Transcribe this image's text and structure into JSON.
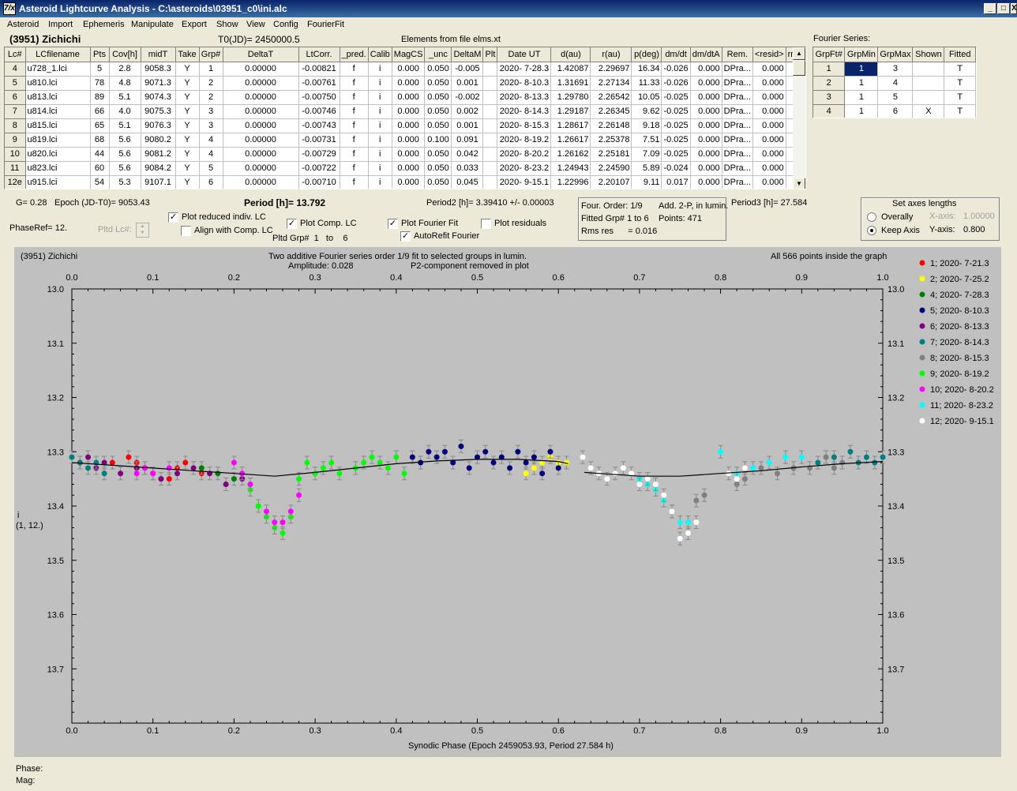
{
  "window": {
    "title": "Asteroid Lightcurve Analysis - C:\\asteroids\\03951_c0\\ini.alc",
    "icon": "7/x",
    "buttons": [
      "_",
      "□",
      "X"
    ]
  },
  "menu": [
    "Asteroid",
    "Import",
    "Ephemeris",
    "Manipulate",
    "Export",
    "Show",
    "View",
    "Config",
    "FourierFit"
  ],
  "header": {
    "asteroid": "(3951) Zichichi",
    "t0": "T0(JD)= 2450000.5",
    "elements": "Elements from file elms.xt",
    "fourier_title": "Fourier Series:"
  },
  "grid": {
    "columns": [
      "Lc#",
      "LCfilename",
      "Pts",
      "Cov[h]",
      "midT",
      "Take",
      "Grp#",
      "DeltaT",
      "LtCorr.",
      "_pred.",
      "Calib",
      "MagCS",
      "_unc",
      "DeltaM",
      "Plt",
      "Date UT",
      "d(au)",
      "r(au)",
      "p(deg)",
      "dm/dt",
      "dm/dtA",
      "Rem.",
      "<resid>",
      "rms res"
    ],
    "rows": [
      [
        "4",
        "u728_1.lci",
        "5",
        "2.8",
        "9058.3",
        "Y",
        "1",
        "0.00000",
        "-0.00821",
        "f",
        "i",
        "0.000",
        "0.050",
        "-0.005",
        "",
        "2020- 7-28.3",
        "1.42087",
        "2.29697",
        "16.34",
        "-0.026",
        "0.000",
        "DPra...",
        "0.000",
        "0.008"
      ],
      [
        "5",
        "u810.lci",
        "78",
        "4.8",
        "9071.3",
        "Y",
        "2",
        "0.00000",
        "-0.00761",
        "f",
        "i",
        "0.000",
        "0.050",
        "0.001",
        "",
        "2020- 8-10.3",
        "1.31691",
        "2.27134",
        "11.33",
        "-0.026",
        "0.000",
        "DPra...",
        "0.000",
        "0.018"
      ],
      [
        "6",
        "u813.lci",
        "89",
        "5.1",
        "9074.3",
        "Y",
        "2",
        "0.00000",
        "-0.00750",
        "f",
        "i",
        "0.000",
        "0.050",
        "-0.002",
        "",
        "2020- 8-13.3",
        "1.29780",
        "2.26542",
        "10.05",
        "-0.025",
        "0.000",
        "DPra...",
        "0.000",
        "0.016"
      ],
      [
        "7",
        "u814.lci",
        "66",
        "4.0",
        "9075.3",
        "Y",
        "3",
        "0.00000",
        "-0.00746",
        "f",
        "i",
        "0.000",
        "0.050",
        "0.002",
        "",
        "2020- 8-14.3",
        "1.29187",
        "2.26345",
        "9.62",
        "-0.025",
        "0.000",
        "DPra...",
        "0.000",
        "0.015"
      ],
      [
        "8",
        "u815.lci",
        "65",
        "5.1",
        "9076.3",
        "Y",
        "3",
        "0.00000",
        "-0.00743",
        "f",
        "i",
        "0.000",
        "0.050",
        "0.001",
        "",
        "2020- 8-15.3",
        "1.28617",
        "2.26148",
        "9.18",
        "-0.025",
        "0.000",
        "DPra...",
        "0.000",
        "0.017"
      ],
      [
        "9",
        "u819.lci",
        "68",
        "5.6",
        "9080.2",
        "Y",
        "4",
        "0.00000",
        "-0.00731",
        "f",
        "i",
        "0.000",
        "0.100",
        "0.091",
        "",
        "2020- 8-19.2",
        "1.26617",
        "2.25378",
        "7.51",
        "-0.025",
        "0.000",
        "DPra...",
        "0.000",
        "0.015"
      ],
      [
        "10",
        "u820.lci",
        "44",
        "5.6",
        "9081.2",
        "Y",
        "4",
        "0.00000",
        "-0.00729",
        "f",
        "i",
        "0.000",
        "0.050",
        "0.042",
        "",
        "2020- 8-20.2",
        "1.26162",
        "2.25181",
        "7.09",
        "-0.025",
        "0.000",
        "DPra...",
        "0.000",
        "0.016"
      ],
      [
        "11",
        "u823.lci",
        "60",
        "5.6",
        "9084.2",
        "Y",
        "5",
        "0.00000",
        "-0.00722",
        "f",
        "i",
        "0.000",
        "0.050",
        "0.033",
        "",
        "2020- 8-23.2",
        "1.24943",
        "2.24590",
        "5.89",
        "-0.024",
        "0.000",
        "DPra...",
        "0.000",
        "0.011"
      ],
      [
        "12e",
        "u915.lci",
        "54",
        "5.3",
        "9107.1",
        "Y",
        "6",
        "0.00000",
        "-0.00710",
        "f",
        "i",
        "0.000",
        "0.050",
        "0.045",
        "",
        "2020- 9-15.1",
        "1.22996",
        "2.20107",
        "9.11",
        "0.017",
        "0.000",
        "DPra...",
        "0.000",
        "0.015"
      ]
    ]
  },
  "fourier": {
    "columns": [
      "GrpFt#",
      "GrpMin",
      "GrpMax",
      "Shown",
      "Fitted"
    ],
    "rows": [
      [
        "1",
        "1",
        "3",
        "",
        "T"
      ],
      [
        "2",
        "1",
        "4",
        "",
        "T"
      ],
      [
        "3",
        "1",
        "5",
        "",
        "T"
      ],
      [
        "4",
        "1",
        "6",
        "X",
        "T"
      ]
    ]
  },
  "controls": {
    "g": "G= 0.28",
    "epoch": "Epoch (JD-T0)= 9053.43",
    "period": "Period [h]= 13.792",
    "period2": "Period2 [h]= 3.39410 +/- 0.00003",
    "period3": "Period3 [h]= 27.584",
    "phaseref": "PhaseRef= 12.",
    "pltd_lc": "Pltd Lc#:",
    "cb_reduced": "Plot reduced indiv. LC",
    "cb_align": "Align with Comp. LC",
    "cb_comp": "Plot Comp. LC",
    "cb_fourier": "Plot Fourier Fit",
    "cb_resid": "Plot residuals",
    "cb_autorefit": "AutoRefit Fourier",
    "pltd_grp": "Pltd Grp#",
    "pltd_grp_from": "1",
    "pltd_to": "to",
    "pltd_grp_to": "6",
    "four_order": "Four. Order:  1/9",
    "add2p": "Add. 2-P, in lumin.",
    "fitted_grp": "Fitted Grp# 1 to 6",
    "points": "Points: 471",
    "rms": "Rms res      = 0.016",
    "axes_title": "Set axes lengths",
    "overally": "Overally",
    "keep_axis": "Keep Axis",
    "xaxis_label": "X-axis:",
    "xaxis_val": "1.00000",
    "yaxis_label": "Y-axis:",
    "yaxis_val": "0.800"
  },
  "plot": {
    "name": "(3951) Zichichi",
    "subtitle1": "Two additive Fourier series order 1/9 fit to selected groups in lumin.",
    "subtitle2": "Amplitude: 0.028",
    "subtitle3": "P2-component removed in plot",
    "note": "All 566 points inside the graph",
    "ylabel1": "i",
    "ylabel2": "(1, 12.)",
    "xlabel": "Synodic Phase (Epoch 2459053.93, Period 27.584 h)"
  },
  "status": {
    "phase": "Phase:",
    "mag": "Mag:"
  },
  "chart_data": {
    "type": "scatter",
    "xlim": [
      0.0,
      1.0
    ],
    "ylim": [
      13.0,
      13.8
    ],
    "y_inverted": true,
    "grid": false,
    "legend": "right",
    "xticks": [
      "0.0",
      "0.1",
      "0.2",
      "0.3",
      "0.4",
      "0.5",
      "0.6",
      "0.7",
      "0.8",
      "0.9",
      "1.0"
    ],
    "yticks": [
      "13.0",
      "13.1",
      "13.2",
      "13.3",
      "13.4",
      "13.5",
      "13.6",
      "13.7"
    ],
    "series": [
      {
        "name": "1; 2020- 7-21.3",
        "color": "#ff0000",
        "points": [
          [
            0.05,
            13.32
          ],
          [
            0.07,
            13.31
          ],
          [
            0.08,
            13.32
          ],
          [
            0.1,
            13.34
          ],
          [
            0.12,
            13.35
          ],
          [
            0.13,
            13.33
          ],
          [
            0.14,
            13.32
          ],
          [
            0.16,
            13.34
          ]
        ]
      },
      {
        "name": "2; 2020- 7-25.2",
        "color": "#ffff00",
        "points": [
          [
            0.56,
            13.34
          ],
          [
            0.57,
            13.33
          ],
          [
            0.58,
            13.32
          ],
          [
            0.59,
            13.31
          ],
          [
            0.6,
            13.32
          ],
          [
            0.61,
            13.32
          ]
        ]
      },
      {
        "name": "4; 2020- 7-28.3",
        "color": "#008000",
        "points": [
          [
            0.16,
            13.33
          ],
          [
            0.18,
            13.34
          ],
          [
            0.2,
            13.35
          ]
        ]
      },
      {
        "name": "5; 2020- 8-10.3",
        "color": "#000080",
        "points": [
          [
            0.42,
            13.31
          ],
          [
            0.43,
            13.32
          ],
          [
            0.44,
            13.3
          ],
          [
            0.45,
            13.31
          ],
          [
            0.46,
            13.3
          ],
          [
            0.47,
            13.32
          ],
          [
            0.48,
            13.29
          ],
          [
            0.49,
            13.33
          ],
          [
            0.5,
            13.31
          ],
          [
            0.51,
            13.3
          ],
          [
            0.52,
            13.32
          ],
          [
            0.53,
            13.31
          ],
          [
            0.54,
            13.33
          ],
          [
            0.55,
            13.3
          ],
          [
            0.56,
            13.32
          ],
          [
            0.57,
            13.31
          ],
          [
            0.58,
            13.34
          ],
          [
            0.59,
            13.3
          ],
          [
            0.6,
            13.33
          ]
        ]
      },
      {
        "name": "6; 2020- 8-13.3",
        "color": "#800080",
        "points": [
          [
            0.01,
            13.32
          ],
          [
            0.02,
            13.31
          ],
          [
            0.03,
            13.33
          ],
          [
            0.04,
            13.32
          ],
          [
            0.06,
            13.34
          ],
          [
            0.08,
            13.33
          ],
          [
            0.09,
            13.33
          ],
          [
            0.11,
            13.35
          ],
          [
            0.13,
            13.34
          ],
          [
            0.15,
            13.33
          ],
          [
            0.17,
            13.34
          ],
          [
            0.19,
            13.36
          ],
          [
            0.21,
            13.35
          ]
        ]
      },
      {
        "name": "7; 2020- 8-14.3",
        "color": "#008080",
        "points": [
          [
            0.0,
            13.31
          ],
          [
            0.01,
            13.32
          ],
          [
            0.02,
            13.33
          ],
          [
            0.03,
            13.32
          ],
          [
            0.04,
            13.34
          ],
          [
            0.92,
            13.32
          ],
          [
            0.94,
            13.31
          ],
          [
            0.96,
            13.3
          ],
          [
            0.97,
            13.32
          ],
          [
            0.98,
            13.31
          ],
          [
            0.99,
            13.32
          ],
          [
            1.0,
            13.31
          ]
        ]
      },
      {
        "name": "8; 2020- 8-15.3",
        "color": "#808080",
        "points": [
          [
            0.77,
            13.39
          ],
          [
            0.78,
            13.38
          ],
          [
            0.82,
            13.36
          ],
          [
            0.83,
            13.35
          ],
          [
            0.85,
            13.33
          ],
          [
            0.87,
            13.34
          ],
          [
            0.89,
            13.33
          ],
          [
            0.91,
            13.33
          ],
          [
            0.93,
            13.31
          ],
          [
            0.94,
            13.33
          ],
          [
            0.95,
            13.32
          ]
        ]
      },
      {
        "name": "9; 2020- 8-19.2",
        "color": "#00ff00",
        "points": [
          [
            0.22,
            13.37
          ],
          [
            0.23,
            13.4
          ],
          [
            0.24,
            13.42
          ],
          [
            0.25,
            13.44
          ],
          [
            0.26,
            13.45
          ],
          [
            0.27,
            13.42
          ],
          [
            0.28,
            13.35
          ],
          [
            0.29,
            13.32
          ],
          [
            0.3,
            13.34
          ],
          [
            0.31,
            13.33
          ],
          [
            0.32,
            13.32
          ],
          [
            0.33,
            13.34
          ],
          [
            0.35,
            13.33
          ],
          [
            0.36,
            13.32
          ],
          [
            0.37,
            13.31
          ],
          [
            0.38,
            13.32
          ],
          [
            0.39,
            13.33
          ],
          [
            0.4,
            13.31
          ],
          [
            0.41,
            13.34
          ]
        ]
      },
      {
        "name": "10; 2020- 8-20.2",
        "color": "#ff00ff",
        "points": [
          [
            0.08,
            13.34
          ],
          [
            0.09,
            13.33
          ],
          [
            0.1,
            13.34
          ],
          [
            0.12,
            13.33
          ],
          [
            0.2,
            13.32
          ],
          [
            0.21,
            13.34
          ],
          [
            0.22,
            13.36
          ],
          [
            0.24,
            13.41
          ],
          [
            0.25,
            13.43
          ],
          [
            0.26,
            13.43
          ],
          [
            0.27,
            13.41
          ],
          [
            0.28,
            13.38
          ]
        ]
      },
      {
        "name": "11; 2020- 8-23.2",
        "color": "#00ffff",
        "points": [
          [
            0.7,
            13.35
          ],
          [
            0.71,
            13.36
          ],
          [
            0.72,
            13.37
          ],
          [
            0.73,
            13.39
          ],
          [
            0.74,
            13.41
          ],
          [
            0.75,
            13.43
          ],
          [
            0.76,
            13.43
          ],
          [
            0.8,
            13.3
          ],
          [
            0.82,
            13.34
          ],
          [
            0.84,
            13.33
          ],
          [
            0.86,
            13.32
          ],
          [
            0.88,
            13.31
          ],
          [
            0.9,
            13.31
          ]
        ]
      },
      {
        "name": "12; 2020- 9-15.1",
        "color": "#ffffff",
        "points": [
          [
            0.63,
            13.31
          ],
          [
            0.64,
            13.33
          ],
          [
            0.65,
            13.34
          ],
          [
            0.66,
            13.35
          ],
          [
            0.67,
            13.34
          ],
          [
            0.68,
            13.33
          ],
          [
            0.69,
            13.34
          ],
          [
            0.7,
            13.36
          ],
          [
            0.71,
            13.35
          ],
          [
            0.72,
            13.36
          ],
          [
            0.73,
            13.38
          ],
          [
            0.74,
            13.41
          ],
          [
            0.75,
            13.46
          ],
          [
            0.76,
            13.45
          ],
          [
            0.77,
            13.43
          ],
          [
            0.81,
            13.34
          ],
          [
            0.82,
            13.35
          ],
          [
            0.83,
            13.33
          ]
        ]
      }
    ],
    "fit_curve": {
      "x": [
        0.0,
        0.05,
        0.1,
        0.15,
        0.2,
        0.25,
        0.3,
        0.35,
        0.4,
        0.45,
        0.5,
        0.55,
        0.6,
        0.612
      ],
      "y": [
        13.32,
        13.325,
        13.33,
        13.335,
        13.34,
        13.345,
        13.338,
        13.33,
        13.322,
        13.317,
        13.314,
        13.314,
        13.318,
        13.322
      ],
      "x2": [
        0.632,
        0.65,
        0.7,
        0.75,
        0.8,
        0.85,
        0.9,
        0.95,
        1.0
      ],
      "y2": [
        13.338,
        13.34,
        13.345,
        13.345,
        13.34,
        13.335,
        13.328,
        13.322,
        13.318
      ]
    }
  }
}
